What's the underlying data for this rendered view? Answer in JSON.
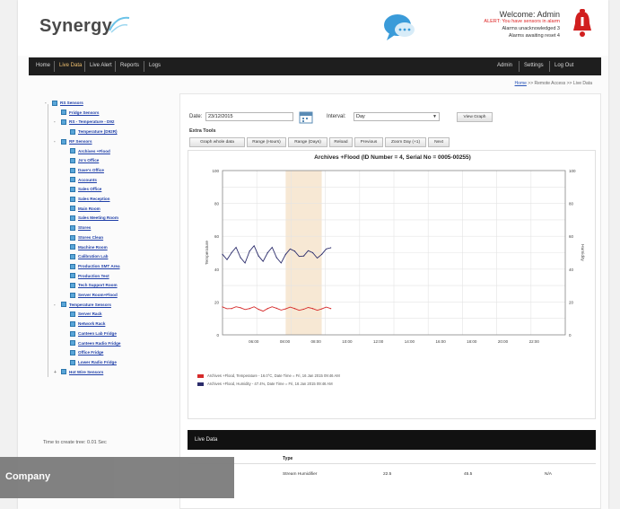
{
  "header": {
    "logo_text": "Synergy",
    "welcome": "Welcome: Admin",
    "alert_line": "ALERT: You have sensors in alarm",
    "alarm_line1": "Alarms unacknowledged 3",
    "alarm_line2": "Alarms awaiting reset 4"
  },
  "nav": {
    "left": [
      "Home",
      "Live Data",
      "Live Alert",
      "Reports",
      "Logs"
    ],
    "right": [
      "Admin",
      "Settings",
      "Log Out"
    ]
  },
  "breadcrumb": {
    "home": "Home",
    "rest": ">> Remote Access >> Live Data"
  },
  "tree": [
    {
      "label": "RS Sensors",
      "level": 0,
      "pm": "-"
    },
    {
      "label": "Fridge Sensors",
      "level": 1,
      "pm": ""
    },
    {
      "label": "RS - Temperature - D92",
      "level": 1,
      "pm": "-"
    },
    {
      "label": "Temperature (D92R)",
      "level": 2,
      "pm": ""
    },
    {
      "label": "RF Sensors",
      "level": 1,
      "pm": "-"
    },
    {
      "label": "Archives +Flood",
      "level": 2,
      "pm": ""
    },
    {
      "label": "Jo's Office",
      "level": 2,
      "pm": ""
    },
    {
      "label": "Dave's Office",
      "level": 2,
      "pm": ""
    },
    {
      "label": "Accounts",
      "level": 2,
      "pm": ""
    },
    {
      "label": "Sales Office",
      "level": 2,
      "pm": ""
    },
    {
      "label": "Sales Reception",
      "level": 2,
      "pm": ""
    },
    {
      "label": "Main Room",
      "level": 2,
      "pm": ""
    },
    {
      "label": "Sales Meeting Room",
      "level": 2,
      "pm": ""
    },
    {
      "label": "Stores",
      "level": 2,
      "pm": ""
    },
    {
      "label": "Stores Clean",
      "level": 2,
      "pm": ""
    },
    {
      "label": "Machine Room",
      "level": 2,
      "pm": ""
    },
    {
      "label": "Calibration Lab",
      "level": 2,
      "pm": ""
    },
    {
      "label": "Production SMT Area",
      "level": 2,
      "pm": ""
    },
    {
      "label": "Production Test",
      "level": 2,
      "pm": ""
    },
    {
      "label": "Tech Support Room",
      "level": 2,
      "pm": ""
    },
    {
      "label": "Server Room+Flood",
      "level": 2,
      "pm": ""
    },
    {
      "label": "Temperature Sensors",
      "level": 1,
      "pm": "-"
    },
    {
      "label": "Server Rack",
      "level": 2,
      "pm": ""
    },
    {
      "label": "Network Rack",
      "level": 2,
      "pm": ""
    },
    {
      "label": "Canteen Lab Fridge",
      "level": 2,
      "pm": ""
    },
    {
      "label": "Canteen Radio Fridge",
      "level": 2,
      "pm": ""
    },
    {
      "label": "Office Fridge",
      "level": 2,
      "pm": ""
    },
    {
      "label": "Lower Radio Fridge",
      "level": 2,
      "pm": ""
    },
    {
      "label": "Hot Wire Sensors",
      "level": 1,
      "pm": "+"
    }
  ],
  "tree_footer": "Time to create tree: 0.01 Sec",
  "filters": {
    "date_label": "Date:",
    "date_value": "23/12/2015",
    "interval_label": "Interval:",
    "interval_value": "Day",
    "view_button": "View Graph"
  },
  "extra_tools": {
    "title": "Extra Tools",
    "buttons": [
      "Graph whole data",
      "Range (Hours)",
      "Range (Days)",
      "Reload",
      "Previous",
      "Zoom Day (+1)",
      "Next"
    ]
  },
  "chart_data": {
    "type": "line",
    "title": "Archives +Flood (ID Number = 4, Serial No = 0005-00255)",
    "ylabel_left": "Temperature",
    "ylabel_right": "Humidity",
    "y_left_ticks": [
      "100",
      "80",
      "60",
      "40",
      "20",
      "0"
    ],
    "y_right_ticks": [
      "100",
      "80",
      "60",
      "40",
      "20",
      "0"
    ],
    "x_ticks": [
      "06:00",
      "08:00",
      "08:00",
      "10:00",
      "12:00",
      "14:00",
      "16:00",
      "18:00",
      "20:00",
      "22:00"
    ],
    "ylim": [
      0,
      100
    ],
    "highlight_range_hours": [
      7.5,
      9.5
    ],
    "series": [
      {
        "name": "Archives +Flood, Temperature - 16.0°C, Date Time = Fri, 16 Jan 2015 09:46 AM",
        "color": "#d62b2b",
        "x_hours": [
          4,
          4.5,
          5,
          5.5,
          6,
          6.5,
          7,
          7.5,
          8,
          8.5,
          9,
          9.5,
          10
        ],
        "values": [
          17,
          16,
          16.5,
          16,
          15.5,
          16,
          16.2,
          15.8,
          16,
          15.6,
          16,
          15.8,
          16
        ]
      },
      {
        "name": "Archives +Flood, Humidity - 47.4%, Date Time = Fri, 16 Jan 2015 09:46 AM",
        "color": "#2b2c6b",
        "x_hours": [
          4,
          4.5,
          5,
          5.5,
          6,
          6.5,
          7,
          7.5,
          8,
          8.5,
          9,
          9.5,
          10
        ],
        "values": [
          49,
          50,
          47,
          51,
          48,
          50,
          47,
          49,
          51,
          48,
          50,
          49,
          53
        ]
      }
    ]
  },
  "live_data": {
    "title": "Live Data",
    "headers": [
      "Type"
    ],
    "row": [
      "Stream Humidifier",
      "22.5",
      "45.5",
      "N/A"
    ]
  },
  "overlay": {
    "company": "Company"
  }
}
